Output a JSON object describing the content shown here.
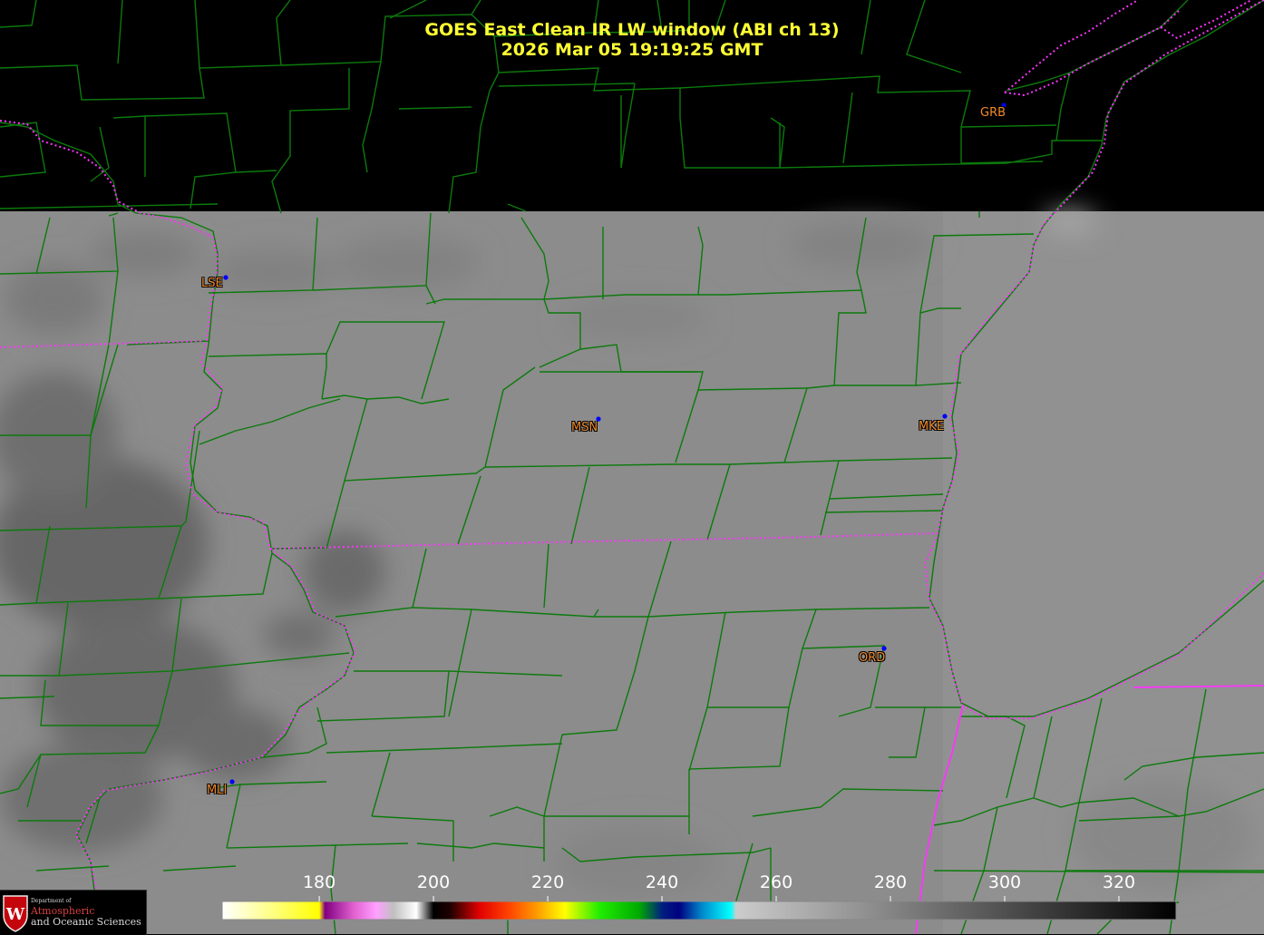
{
  "header": {
    "title": "GOES East Clean IR LW window (ABI ch 13)",
    "timestamp": "2026 Mar 05  19:19:25 GMT"
  },
  "stations": [
    {
      "id": "GRB"
    },
    {
      "id": "LSE"
    },
    {
      "id": "MSN"
    },
    {
      "id": "MKE"
    },
    {
      "id": "ORD"
    },
    {
      "id": "MLI"
    }
  ],
  "colorbar": {
    "ticks": [
      "180",
      "200",
      "220",
      "240",
      "260",
      "280",
      "300",
      "320"
    ],
    "stops": [
      {
        "value": 163,
        "color": "#ffffff"
      },
      {
        "value": 172,
        "color": "#ffff80"
      },
      {
        "value": 180,
        "color": "#ffff00"
      },
      {
        "value": 181,
        "color": "#800080"
      },
      {
        "value": 186,
        "color": "#e060d0"
      },
      {
        "value": 190,
        "color": "#ffa0ff"
      },
      {
        "value": 193,
        "color": "#c0c0c0"
      },
      {
        "value": 197,
        "color": "#ffffff"
      },
      {
        "value": 200,
        "color": "#000000"
      },
      {
        "value": 203,
        "color": "#200000"
      },
      {
        "value": 208,
        "color": "#e00000"
      },
      {
        "value": 213,
        "color": "#ff4000"
      },
      {
        "value": 218,
        "color": "#ff9900"
      },
      {
        "value": 223,
        "color": "#ffff00"
      },
      {
        "value": 229,
        "color": "#22ee00"
      },
      {
        "value": 236,
        "color": "#00aa00"
      },
      {
        "value": 240,
        "color": "#001f80"
      },
      {
        "value": 243,
        "color": "#000080"
      },
      {
        "value": 247,
        "color": "#0088cc"
      },
      {
        "value": 252,
        "color": "#00ffff"
      },
      {
        "value": 253,
        "color": "#cccccc"
      },
      {
        "value": 330,
        "color": "#000000"
      }
    ]
  },
  "colors": {
    "county_lines": "#0c7a0c",
    "state_lines": "#ff33ff",
    "station_label": "#f08a2a",
    "station_dot": "#0000ff",
    "title": "#ffff33"
  },
  "logo": {
    "line1": "Department of",
    "line2": "Atmospheric",
    "line3": "and Oceanic Sciences",
    "emblem": "W"
  }
}
